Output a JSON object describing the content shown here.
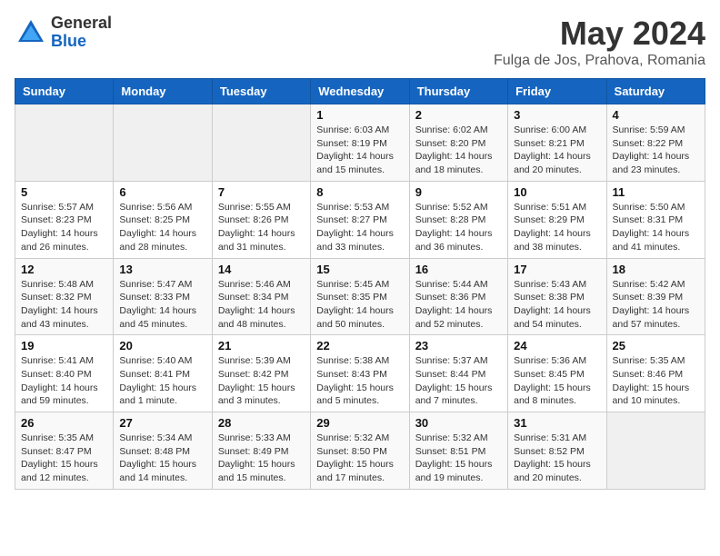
{
  "header": {
    "logo_general": "General",
    "logo_blue": "Blue",
    "month_title": "May 2024",
    "location": "Fulga de Jos, Prahova, Romania"
  },
  "weekdays": [
    "Sunday",
    "Monday",
    "Tuesday",
    "Wednesday",
    "Thursday",
    "Friday",
    "Saturday"
  ],
  "weeks": [
    [
      {
        "day": "",
        "sunrise": "",
        "sunset": "",
        "daylight": ""
      },
      {
        "day": "",
        "sunrise": "",
        "sunset": "",
        "daylight": ""
      },
      {
        "day": "",
        "sunrise": "",
        "sunset": "",
        "daylight": ""
      },
      {
        "day": "1",
        "sunrise": "Sunrise: 6:03 AM",
        "sunset": "Sunset: 8:19 PM",
        "daylight": "Daylight: 14 hours and 15 minutes."
      },
      {
        "day": "2",
        "sunrise": "Sunrise: 6:02 AM",
        "sunset": "Sunset: 8:20 PM",
        "daylight": "Daylight: 14 hours and 18 minutes."
      },
      {
        "day": "3",
        "sunrise": "Sunrise: 6:00 AM",
        "sunset": "Sunset: 8:21 PM",
        "daylight": "Daylight: 14 hours and 20 minutes."
      },
      {
        "day": "4",
        "sunrise": "Sunrise: 5:59 AM",
        "sunset": "Sunset: 8:22 PM",
        "daylight": "Daylight: 14 hours and 23 minutes."
      }
    ],
    [
      {
        "day": "5",
        "sunrise": "Sunrise: 5:57 AM",
        "sunset": "Sunset: 8:23 PM",
        "daylight": "Daylight: 14 hours and 26 minutes."
      },
      {
        "day": "6",
        "sunrise": "Sunrise: 5:56 AM",
        "sunset": "Sunset: 8:25 PM",
        "daylight": "Daylight: 14 hours and 28 minutes."
      },
      {
        "day": "7",
        "sunrise": "Sunrise: 5:55 AM",
        "sunset": "Sunset: 8:26 PM",
        "daylight": "Daylight: 14 hours and 31 minutes."
      },
      {
        "day": "8",
        "sunrise": "Sunrise: 5:53 AM",
        "sunset": "Sunset: 8:27 PM",
        "daylight": "Daylight: 14 hours and 33 minutes."
      },
      {
        "day": "9",
        "sunrise": "Sunrise: 5:52 AM",
        "sunset": "Sunset: 8:28 PM",
        "daylight": "Daylight: 14 hours and 36 minutes."
      },
      {
        "day": "10",
        "sunrise": "Sunrise: 5:51 AM",
        "sunset": "Sunset: 8:29 PM",
        "daylight": "Daylight: 14 hours and 38 minutes."
      },
      {
        "day": "11",
        "sunrise": "Sunrise: 5:50 AM",
        "sunset": "Sunset: 8:31 PM",
        "daylight": "Daylight: 14 hours and 41 minutes."
      }
    ],
    [
      {
        "day": "12",
        "sunrise": "Sunrise: 5:48 AM",
        "sunset": "Sunset: 8:32 PM",
        "daylight": "Daylight: 14 hours and 43 minutes."
      },
      {
        "day": "13",
        "sunrise": "Sunrise: 5:47 AM",
        "sunset": "Sunset: 8:33 PM",
        "daylight": "Daylight: 14 hours and 45 minutes."
      },
      {
        "day": "14",
        "sunrise": "Sunrise: 5:46 AM",
        "sunset": "Sunset: 8:34 PM",
        "daylight": "Daylight: 14 hours and 48 minutes."
      },
      {
        "day": "15",
        "sunrise": "Sunrise: 5:45 AM",
        "sunset": "Sunset: 8:35 PM",
        "daylight": "Daylight: 14 hours and 50 minutes."
      },
      {
        "day": "16",
        "sunrise": "Sunrise: 5:44 AM",
        "sunset": "Sunset: 8:36 PM",
        "daylight": "Daylight: 14 hours and 52 minutes."
      },
      {
        "day": "17",
        "sunrise": "Sunrise: 5:43 AM",
        "sunset": "Sunset: 8:38 PM",
        "daylight": "Daylight: 14 hours and 54 minutes."
      },
      {
        "day": "18",
        "sunrise": "Sunrise: 5:42 AM",
        "sunset": "Sunset: 8:39 PM",
        "daylight": "Daylight: 14 hours and 57 minutes."
      }
    ],
    [
      {
        "day": "19",
        "sunrise": "Sunrise: 5:41 AM",
        "sunset": "Sunset: 8:40 PM",
        "daylight": "Daylight: 14 hours and 59 minutes."
      },
      {
        "day": "20",
        "sunrise": "Sunrise: 5:40 AM",
        "sunset": "Sunset: 8:41 PM",
        "daylight": "Daylight: 15 hours and 1 minute."
      },
      {
        "day": "21",
        "sunrise": "Sunrise: 5:39 AM",
        "sunset": "Sunset: 8:42 PM",
        "daylight": "Daylight: 15 hours and 3 minutes."
      },
      {
        "day": "22",
        "sunrise": "Sunrise: 5:38 AM",
        "sunset": "Sunset: 8:43 PM",
        "daylight": "Daylight: 15 hours and 5 minutes."
      },
      {
        "day": "23",
        "sunrise": "Sunrise: 5:37 AM",
        "sunset": "Sunset: 8:44 PM",
        "daylight": "Daylight: 15 hours and 7 minutes."
      },
      {
        "day": "24",
        "sunrise": "Sunrise: 5:36 AM",
        "sunset": "Sunset: 8:45 PM",
        "daylight": "Daylight: 15 hours and 8 minutes."
      },
      {
        "day": "25",
        "sunrise": "Sunrise: 5:35 AM",
        "sunset": "Sunset: 8:46 PM",
        "daylight": "Daylight: 15 hours and 10 minutes."
      }
    ],
    [
      {
        "day": "26",
        "sunrise": "Sunrise: 5:35 AM",
        "sunset": "Sunset: 8:47 PM",
        "daylight": "Daylight: 15 hours and 12 minutes."
      },
      {
        "day": "27",
        "sunrise": "Sunrise: 5:34 AM",
        "sunset": "Sunset: 8:48 PM",
        "daylight": "Daylight: 15 hours and 14 minutes."
      },
      {
        "day": "28",
        "sunrise": "Sunrise: 5:33 AM",
        "sunset": "Sunset: 8:49 PM",
        "daylight": "Daylight: 15 hours and 15 minutes."
      },
      {
        "day": "29",
        "sunrise": "Sunrise: 5:32 AM",
        "sunset": "Sunset: 8:50 PM",
        "daylight": "Daylight: 15 hours and 17 minutes."
      },
      {
        "day": "30",
        "sunrise": "Sunrise: 5:32 AM",
        "sunset": "Sunset: 8:51 PM",
        "daylight": "Daylight: 15 hours and 19 minutes."
      },
      {
        "day": "31",
        "sunrise": "Sunrise: 5:31 AM",
        "sunset": "Sunset: 8:52 PM",
        "daylight": "Daylight: 15 hours and 20 minutes."
      },
      {
        "day": "",
        "sunrise": "",
        "sunset": "",
        "daylight": ""
      }
    ]
  ]
}
